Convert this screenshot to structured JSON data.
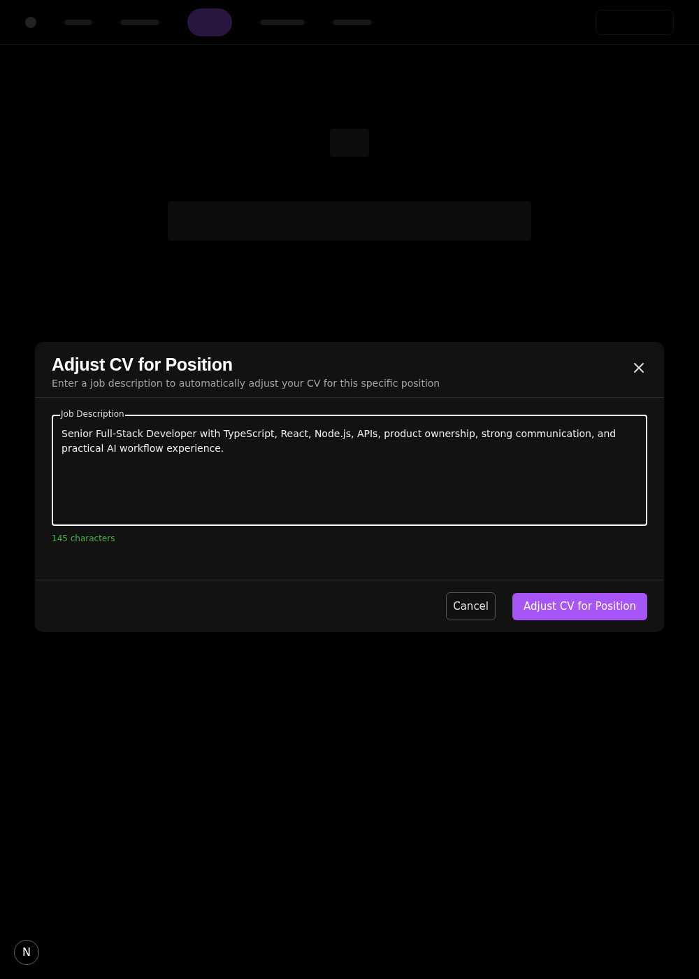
{
  "dialog": {
    "title": "Adjust CV for Position",
    "subtitle": "Enter a job description to automatically adjust your CV for this specific position",
    "field": {
      "label": "Job Description",
      "value": "Senior Full-Stack Developer with TypeScript, React, Node.js, APIs, product ownership, strong communication, and practical AI workflow experience."
    },
    "counter": "145 characters",
    "buttons": [
      {
        "kind": "secondary",
        "label": "Cancel"
      },
      {
        "kind": "primary",
        "label": "Adjust CV for Position"
      }
    ]
  },
  "badge": "N"
}
